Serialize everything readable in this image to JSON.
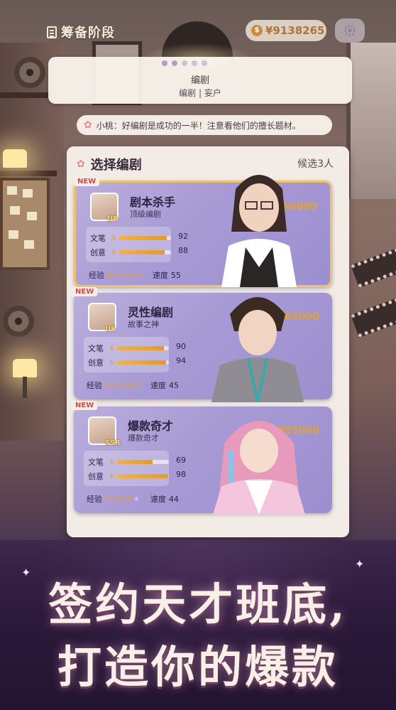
{
  "top_bar": {
    "phase_label": "筹备阶段",
    "money": "¥9138265"
  },
  "stage": {
    "title": "编剧",
    "subtitle": "编剧 | 妄户",
    "dots_total": 5,
    "dots_active": 2
  },
  "tip": {
    "text": "小桃：好编剧是成功的一半！注意看他们的擅长题材。"
  },
  "panel": {
    "title": "选择编剧",
    "candidate_count": "候选3人"
  },
  "writers": [
    {
      "badge": "NEW",
      "name": "剧本杀手",
      "title": "顶级编剧",
      "rarity": "UR",
      "price": "¥60000",
      "stat1_label": "文笔",
      "stat1_value": "92",
      "stat2_label": "创意",
      "stat2_value": "88",
      "exp_label": "经验",
      "exp_stars": 5,
      "speed_label": "速度",
      "speed_value": "55",
      "selected": true
    },
    {
      "badge": "NEW",
      "name": "灵性编剧",
      "title": "故事之神",
      "rarity": "UR",
      "price": "¥65000",
      "stat1_label": "文笔",
      "stat1_value": "90",
      "stat2_label": "创意",
      "stat2_value": "94",
      "exp_label": "经验",
      "exp_stars": 5,
      "speed_label": "速度",
      "speed_value": "45",
      "selected": false
    },
    {
      "badge": "NEW",
      "name": "爆款奇才",
      "title": "爆款奇才",
      "rarity": "SSR",
      "price": "¥55000",
      "stat1_label": "文笔",
      "stat1_value": "69",
      "stat2_label": "创意",
      "stat2_value": "98",
      "exp_label": "经验",
      "exp_stars": 4,
      "speed_label": "速度",
      "speed_value": "44",
      "selected": false
    }
  ],
  "banner": {
    "line1": "签约天才班底,",
    "line2": "打造你的爆款"
  },
  "colors": {
    "card_purple": "#a79ad4",
    "price_gold": "#e2a035",
    "selected_border": "#ecc36a",
    "panel_bg": "#f3ece6"
  },
  "icons": {
    "phase": "clipboard-icon",
    "money": "money-bag-icon",
    "settings": "gear-icon",
    "tip": "flower-icon",
    "panel": "flower-icon"
  }
}
